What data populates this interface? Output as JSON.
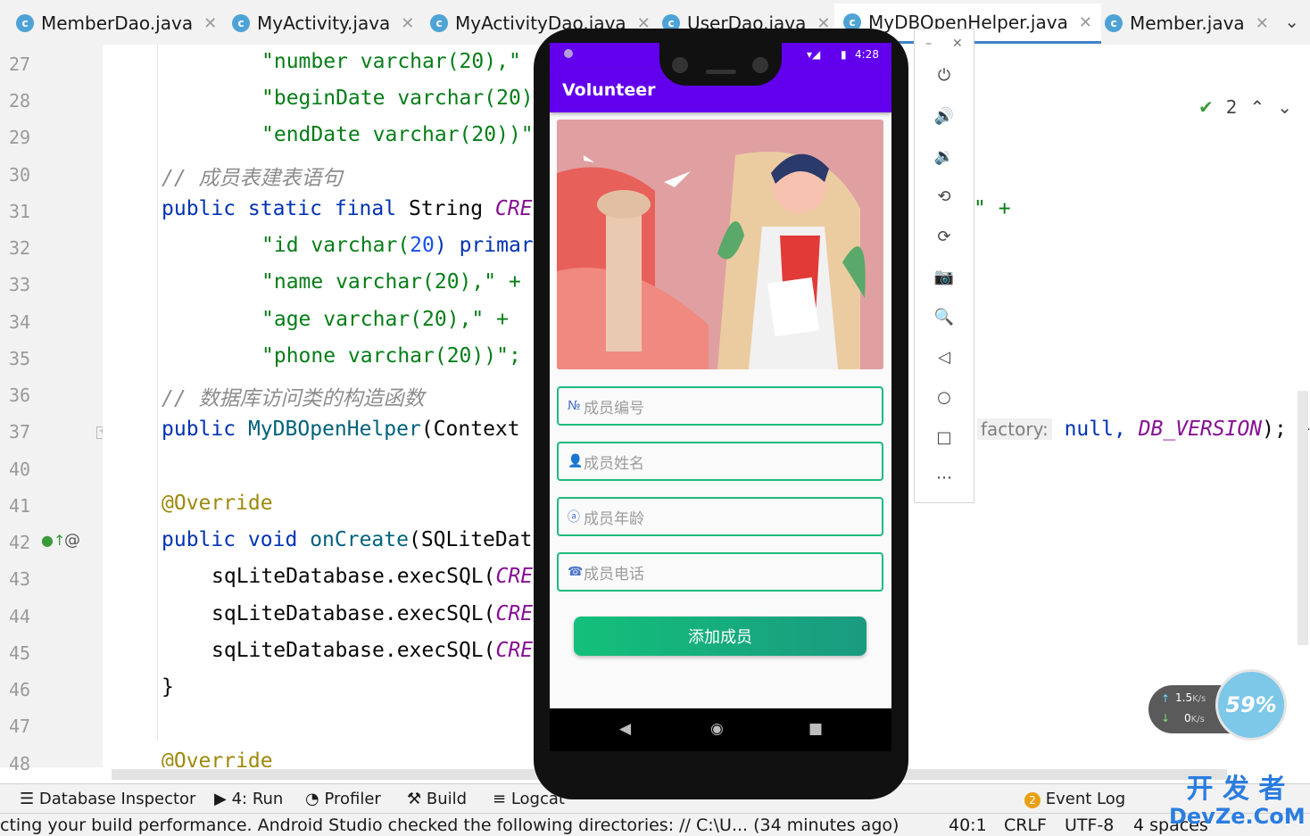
{
  "tabs": [
    {
      "label": "MemberDao.java",
      "icon": "class-icon"
    },
    {
      "label": "MyActivity.java",
      "icon": "class-icon"
    },
    {
      "label": "MyActivityDao.java",
      "icon": "class-icon"
    },
    {
      "label": "UserDao.java",
      "icon": "class-icon"
    },
    {
      "label": "MyDBOpenHelper.java",
      "icon": "class-icon",
      "active": true
    },
    {
      "label": "Member.java",
      "icon": "class-icon"
    }
  ],
  "editor": {
    "inspection_count": "2",
    "line_numbers": [
      "27",
      "28",
      "29",
      "30",
      "31",
      "32",
      "33",
      "34",
      "35",
      "36",
      "37",
      "40",
      "41",
      "42",
      "43",
      "44",
      "45",
      "46",
      "47",
      "48"
    ],
    "lines": {
      "l27": "\"number varchar(20),\"",
      "l28": "\"beginDate varchar(20)",
      "l29": "\"endDate varchar(20))\"",
      "l30": "// 成员表建表语句",
      "l31_kw": "public static final",
      "l31_type": "String",
      "l31_fld": "CRE",
      "l31_tail": "\" +",
      "l32_str": "\"id varchar(",
      "l32_num": "20",
      "l32_rest": ") primar",
      "l33": "\"name varchar(20),\" +",
      "l34": "\"age varchar(20),\" +",
      "l35": "\"phone varchar(20))\";",
      "l36": "// 数据库访问类的构造函数",
      "l37_kw": "public",
      "l37_name": "MyDBOpenHelper",
      "l37_rest": "(Context",
      "l37_hint": "factory:",
      "l37_tail_null": "null,",
      "l37_tail_fld": "DB_VERSION",
      "l37_tail_end": "); }",
      "l41": "@Override",
      "l42_kw": "public void",
      "l42_name": "onCreate",
      "l42_rest": "(SQLiteDat",
      "l43": "sqLiteDatabase.execSQL(",
      "l43_fld": "CRE",
      "l44": "sqLiteDatabase.execSQL(",
      "l44_fld": "CRE",
      "l45": "sqLiteDatabase.execSQL(",
      "l45_fld": "CRE",
      "l46": "}",
      "l48": "@Override"
    }
  },
  "toolwindows": {
    "database_inspector": "Database Inspector",
    "run": "4: Run",
    "profiler": "Profiler",
    "build": "Build",
    "logcat": "Logcat",
    "event_log": "Event Log",
    "event_log_count": "2"
  },
  "statusbar": {
    "message": "cting your build performance. Android Studio checked the following directories: // C:\\U... (34 minutes ago)",
    "position": "40:1",
    "line_sep": "CRLF",
    "encoding": "UTF-8",
    "indent": "4 spaces"
  },
  "phone": {
    "time": "4:28",
    "app_title": "Volunteer",
    "fields": [
      {
        "icon": "№",
        "placeholder": "成员编号"
      },
      {
        "icon": "👤",
        "placeholder": "成员姓名"
      },
      {
        "icon": "ⓐ",
        "placeholder": "成员年龄"
      },
      {
        "icon": "☎",
        "placeholder": "成员电话"
      }
    ],
    "add_button": "添加成员"
  },
  "net_widget": {
    "up": "1.5",
    "up_unit": "K/s",
    "down": "0",
    "down_unit": "K/s",
    "percent": "59%"
  },
  "watermark": {
    "line1": "开 发 者",
    "line2": "DevZe.CoM"
  }
}
